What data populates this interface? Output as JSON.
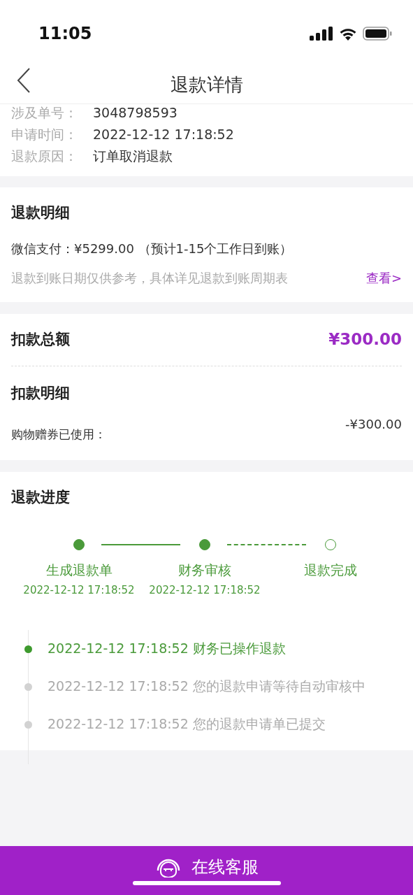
{
  "status_bar": {
    "time": "11:05"
  },
  "nav": {
    "title": "退款详情"
  },
  "info": [
    {
      "label": "涉及单号：",
      "value": "3048798593"
    },
    {
      "label": "申请时间：",
      "value": "2022-12-12 17:18:52"
    },
    {
      "label": "退款原因：",
      "value": "订单取消退款"
    }
  ],
  "refund_detail": {
    "title": "退款明细",
    "payment": "微信支付：¥5299.00 （预计1-15个工作日到账）",
    "note": "退款到账日期仅供参考，具体详见退款到账周期表",
    "link": "查看>"
  },
  "deduction": {
    "total_label": "扣款总额",
    "total": "¥300.00",
    "detail_title": "扣款明细",
    "items": [
      {
        "label": "购物赠券已使用：",
        "amount": "-¥300.00"
      }
    ]
  },
  "progress": {
    "title": "退款进度",
    "steps": [
      {
        "label": "生成退款单",
        "time": "2022-12-12 17:18:52",
        "done": true
      },
      {
        "label": "财务审核",
        "time": "2022-12-12 17:18:52",
        "done": true
      },
      {
        "label": "退款完成",
        "done": false
      }
    ],
    "log": [
      {
        "text": "2022-12-12 17:18:52 财务已操作退款",
        "active": true
      },
      {
        "text": "2022-12-12 17:18:52 您的退款申请等待自动审核中",
        "active": false
      },
      {
        "text": "2022-12-12 17:18:52 您的退款申请单已提交",
        "active": false
      }
    ]
  },
  "footer": {
    "button": "在线客服"
  }
}
